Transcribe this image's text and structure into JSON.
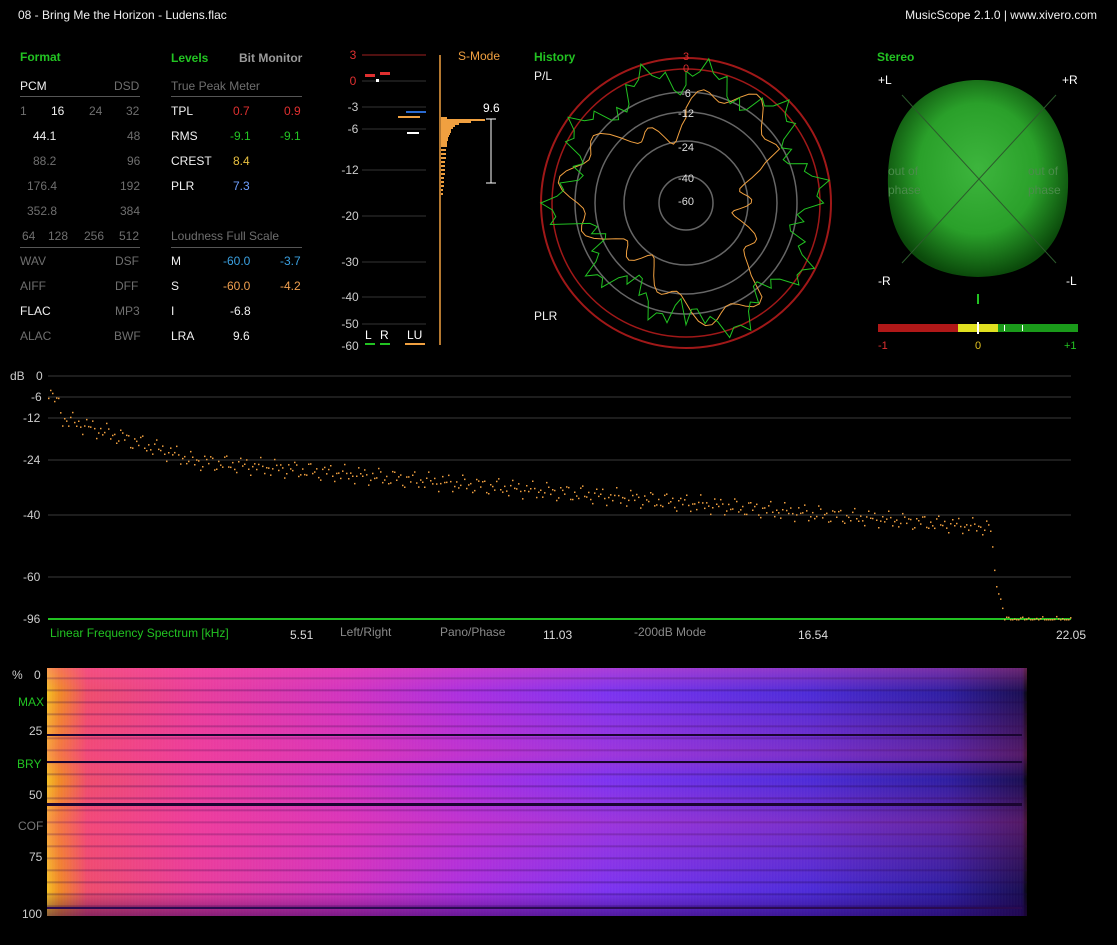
{
  "window": {
    "title": "08 - Bring Me the Horizon - Ludens.flac",
    "app": "MusicScope 2.1.0 | www.xivero.com"
  },
  "format": {
    "title": "Format",
    "pcm": "PCM",
    "dsd": "DSD",
    "bits": [
      "1",
      "16",
      "24",
      "32"
    ],
    "rates": [
      {
        "pcm": "44.1",
        "dsd": "48"
      },
      {
        "pcm": "88.2",
        "dsd": "96"
      },
      {
        "pcm": "176.4",
        "dsd": "192"
      },
      {
        "pcm": "352.8",
        "dsd": "384"
      }
    ],
    "dsd_rates": [
      "64",
      "128",
      "256",
      "512"
    ],
    "containers": [
      {
        "left": "WAV",
        "right": "DSF"
      },
      {
        "left": "AIFF",
        "right": "DFF"
      },
      {
        "left": "FLAC",
        "right": "MP3"
      },
      {
        "left": "ALAC",
        "right": "BWF"
      }
    ]
  },
  "levels": {
    "title": "Levels",
    "bit_monitor": "Bit Monitor",
    "true_peak_title": "True Peak Meter",
    "rows": [
      {
        "label": "TPL",
        "left": "0.7",
        "right": "0.9",
        "color": "#e03030"
      },
      {
        "label": "RMS",
        "left": "-9.1",
        "right": "-9.1",
        "color": "#22c322"
      },
      {
        "label": "CREST",
        "left": "8.4",
        "right": "",
        "color": "#e8c040"
      },
      {
        "label": "PLR",
        "left": "7.3",
        "right": "",
        "color": "#6fa0ff"
      }
    ],
    "loudness_title": "Loudness Full Scale",
    "loudness": [
      {
        "label": "M",
        "left": "-60.0",
        "right": "-3.7",
        "color": "#3aa0e0"
      },
      {
        "label": "S",
        "left": "-60.0",
        "right": "-4.2",
        "color": "#f0a050"
      },
      {
        "label": "I",
        "left": "-6.8",
        "right": "",
        "color": "#e0e0e0"
      },
      {
        "label": "LRA",
        "left": "9.6",
        "right": "",
        "color": "#e0e0e0"
      }
    ]
  },
  "meter": {
    "scale": [
      "3",
      "0",
      "-3",
      "-6",
      "-12",
      "-20",
      "-30",
      "-40",
      "-50",
      "-60"
    ],
    "mode": "S-Mode",
    "lra_value": "9.6",
    "ch_l": "L",
    "ch_r": "R",
    "ch_lu": "LU"
  },
  "history": {
    "title": "History",
    "pl": "P/L",
    "plr": "PLR",
    "rings": [
      "3",
      "0",
      "-6",
      "-12",
      "-24",
      "-40",
      "-60"
    ]
  },
  "stereo": {
    "title": "Stereo",
    "pl": "+L",
    "pr": "+R",
    "mr": "-R",
    "ml": "-L",
    "out_left": "out of",
    "out_left2": "phase",
    "out_right": "out of",
    "out_right2": "phase",
    "corr_min": "-1",
    "corr_mid": "0",
    "corr_max": "+1"
  },
  "spectrum": {
    "db_label": "dB",
    "db_ticks": [
      "0",
      "-6",
      "-12",
      "-24",
      "-40",
      "-60",
      "-96"
    ],
    "title": "Linear Frequency Spectrum [kHz]",
    "freq_ticks": [
      "5.51",
      "11.03",
      "16.54",
      "22.05"
    ],
    "left_right": "Left/Right",
    "pano_phase": "Pano/Phase",
    "mode": "-200dB Mode"
  },
  "spectrogram": {
    "pct": "%",
    "ticks": [
      "0",
      "25",
      "50",
      "75",
      "100"
    ],
    "max": "MAX",
    "bry": "BRY",
    "cof": "COF"
  },
  "colors": {
    "green": "#22c322",
    "orange": "#f0a040",
    "red": "#c02020",
    "grid": "#333333"
  }
}
